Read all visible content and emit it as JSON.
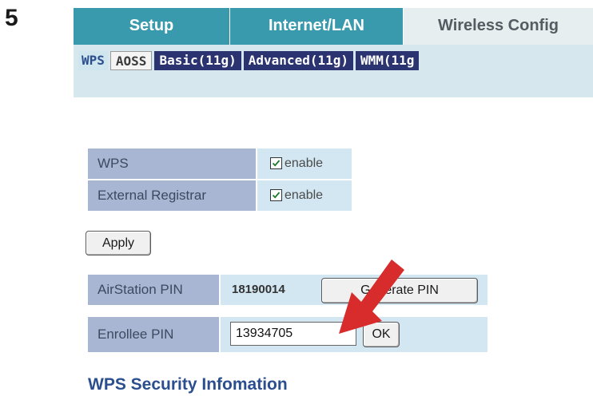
{
  "step_number": "5",
  "main_tabs": [
    {
      "label": "Setup",
      "active": false
    },
    {
      "label": "Internet/LAN",
      "active": false
    },
    {
      "label": "Wireless Config",
      "active": true
    }
  ],
  "sub_tabs": [
    {
      "label": "WPS",
      "state": "current"
    },
    {
      "label": "AOSS",
      "state": "light"
    },
    {
      "label": "Basic(11g)",
      "state": "dark"
    },
    {
      "label": "Advanced(11g)",
      "state": "dark"
    },
    {
      "label": "WMM(11g",
      "state": "dark"
    }
  ],
  "settings": {
    "wps": {
      "label": "WPS",
      "checkbox_label": "enable",
      "checked": true
    },
    "external_registrar": {
      "label": "External Registrar",
      "checkbox_label": "enable",
      "checked": true
    },
    "apply_label": "Apply"
  },
  "pin": {
    "airstation_label": "AirStation PIN",
    "airstation_value": "18190014",
    "generate_label": "Generate PIN",
    "enrollee_label": "Enrollee PIN",
    "enrollee_value": "13934705",
    "ok_label": "OK"
  },
  "section_title": "WPS Security Infomation",
  "colors": {
    "tab_active_bg": "#e7eef0",
    "tab_inactive_bg": "#3a9aad",
    "subtab_dark_bg": "#2b3470",
    "label_cell_bg": "#a8b6d4",
    "value_cell_bg": "#d3e7f2",
    "arrow": "#d82b2b",
    "title_blue": "#2b4e8e"
  }
}
